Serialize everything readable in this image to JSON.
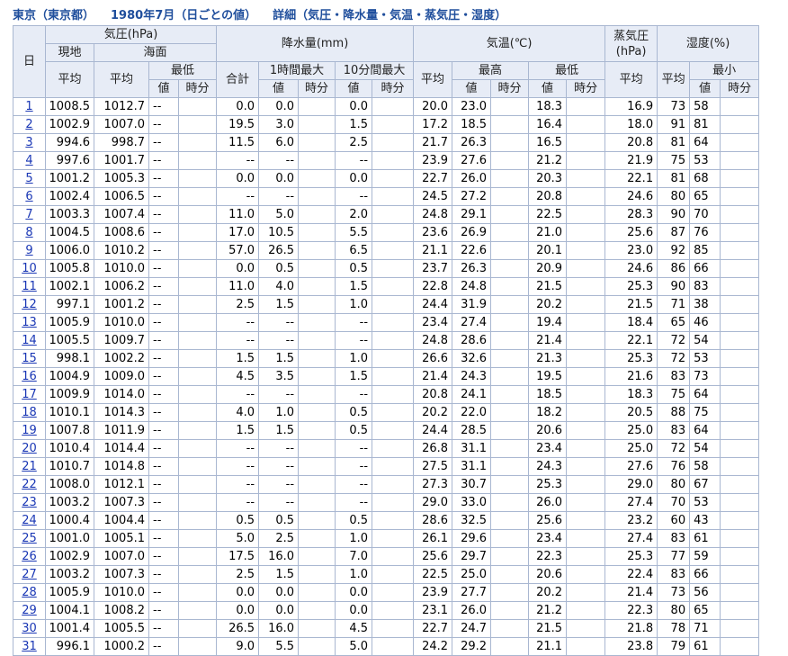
{
  "title": {
    "place": "東京（東京都）",
    "date": "1980年7月（日ごとの値）",
    "detail": "詳細（気圧・降水量・気温・蒸気圧・湿度）"
  },
  "headers": {
    "day": "日",
    "pressure": "気圧(hPa)",
    "station": "現地",
    "sea": "海面",
    "avg": "平均",
    "min": "最低",
    "value": "値",
    "time": "時分",
    "precip": "降水量(mm)",
    "total": "合計",
    "max1h": "1時間最大",
    "max10m": "10分間最大",
    "temp": "気温(℃)",
    "max": "最高",
    "vapor": "蒸気圧(hPa)",
    "humidity": "湿度(%)",
    "hmin": "最小"
  },
  "rows": [
    {
      "day": "1",
      "p_avg": "1008.5",
      "sp_avg": "1012.7",
      "sp_min": "--",
      "sp_min_t": "",
      "pr_total": "0.0",
      "pr_1h": "0.0",
      "pr_1h_t": "",
      "pr_10m": "0.0",
      "pr_10m_t": "",
      "t_avg": "20.0",
      "t_max": "23.0",
      "t_max_t": "",
      "t_min": "18.3",
      "t_min_t": "",
      "vp": "16.9",
      "h_avg": "73",
      "h_min": "58",
      "h_min_t": ""
    },
    {
      "day": "2",
      "p_avg": "1002.9",
      "sp_avg": "1007.0",
      "sp_min": "--",
      "sp_min_t": "",
      "pr_total": "19.5",
      "pr_1h": "3.0",
      "pr_1h_t": "",
      "pr_10m": "1.5",
      "pr_10m_t": "",
      "t_avg": "17.2",
      "t_max": "18.5",
      "t_max_t": "",
      "t_min": "16.4",
      "t_min_t": "",
      "vp": "18.0",
      "h_avg": "91",
      "h_min": "81",
      "h_min_t": ""
    },
    {
      "day": "3",
      "p_avg": "994.6",
      "sp_avg": "998.7",
      "sp_min": "--",
      "sp_min_t": "",
      "pr_total": "11.5",
      "pr_1h": "6.0",
      "pr_1h_t": "",
      "pr_10m": "2.5",
      "pr_10m_t": "",
      "t_avg": "21.7",
      "t_max": "26.3",
      "t_max_t": "",
      "t_min": "16.5",
      "t_min_t": "",
      "vp": "20.8",
      "h_avg": "81",
      "h_min": "64",
      "h_min_t": ""
    },
    {
      "day": "4",
      "p_avg": "997.6",
      "sp_avg": "1001.7",
      "sp_min": "--",
      "sp_min_t": "",
      "pr_total": "--",
      "pr_1h": "--",
      "pr_1h_t": "",
      "pr_10m": "--",
      "pr_10m_t": "",
      "t_avg": "23.9",
      "t_max": "27.6",
      "t_max_t": "",
      "t_min": "21.2",
      "t_min_t": "",
      "vp": "21.9",
      "h_avg": "75",
      "h_min": "53",
      "h_min_t": ""
    },
    {
      "day": "5",
      "p_avg": "1001.2",
      "sp_avg": "1005.3",
      "sp_min": "--",
      "sp_min_t": "",
      "pr_total": "0.0",
      "pr_1h": "0.0",
      "pr_1h_t": "",
      "pr_10m": "0.0",
      "pr_10m_t": "",
      "t_avg": "22.7",
      "t_max": "26.0",
      "t_max_t": "",
      "t_min": "20.3",
      "t_min_t": "",
      "vp": "22.1",
      "h_avg": "81",
      "h_min": "68",
      "h_min_t": ""
    },
    {
      "day": "6",
      "p_avg": "1002.4",
      "sp_avg": "1006.5",
      "sp_min": "--",
      "sp_min_t": "",
      "pr_total": "--",
      "pr_1h": "--",
      "pr_1h_t": "",
      "pr_10m": "--",
      "pr_10m_t": "",
      "t_avg": "24.5",
      "t_max": "27.2",
      "t_max_t": "",
      "t_min": "20.8",
      "t_min_t": "",
      "vp": "24.6",
      "h_avg": "80",
      "h_min": "65",
      "h_min_t": ""
    },
    {
      "day": "7",
      "p_avg": "1003.3",
      "sp_avg": "1007.4",
      "sp_min": "--",
      "sp_min_t": "",
      "pr_total": "11.0",
      "pr_1h": "5.0",
      "pr_1h_t": "",
      "pr_10m": "2.0",
      "pr_10m_t": "",
      "t_avg": "24.8",
      "t_max": "29.1",
      "t_max_t": "",
      "t_min": "22.5",
      "t_min_t": "",
      "vp": "28.3",
      "h_avg": "90",
      "h_min": "70",
      "h_min_t": ""
    },
    {
      "day": "8",
      "p_avg": "1004.5",
      "sp_avg": "1008.6",
      "sp_min": "--",
      "sp_min_t": "",
      "pr_total": "17.0",
      "pr_1h": "10.5",
      "pr_1h_t": "",
      "pr_10m": "5.5",
      "pr_10m_t": "",
      "t_avg": "23.6",
      "t_max": "26.9",
      "t_max_t": "",
      "t_min": "21.0",
      "t_min_t": "",
      "vp": "25.6",
      "h_avg": "87",
      "h_min": "76",
      "h_min_t": ""
    },
    {
      "day": "9",
      "p_avg": "1006.0",
      "sp_avg": "1010.2",
      "sp_min": "--",
      "sp_min_t": "",
      "pr_total": "57.0",
      "pr_1h": "26.5",
      "pr_1h_t": "",
      "pr_10m": "6.5",
      "pr_10m_t": "",
      "t_avg": "21.1",
      "t_max": "22.6",
      "t_max_t": "",
      "t_min": "20.1",
      "t_min_t": "",
      "vp": "23.0",
      "h_avg": "92",
      "h_min": "85",
      "h_min_t": ""
    },
    {
      "day": "10",
      "p_avg": "1005.8",
      "sp_avg": "1010.0",
      "sp_min": "--",
      "sp_min_t": "",
      "pr_total": "0.0",
      "pr_1h": "0.5",
      "pr_1h_t": "",
      "pr_10m": "0.5",
      "pr_10m_t": "",
      "t_avg": "23.7",
      "t_max": "26.3",
      "t_max_t": "",
      "t_min": "20.9",
      "t_min_t": "",
      "vp": "24.6",
      "h_avg": "86",
      "h_min": "66",
      "h_min_t": ""
    },
    {
      "day": "11",
      "p_avg": "1002.1",
      "sp_avg": "1006.2",
      "sp_min": "--",
      "sp_min_t": "",
      "pr_total": "11.0",
      "pr_1h": "4.0",
      "pr_1h_t": "",
      "pr_10m": "1.5",
      "pr_10m_t": "",
      "t_avg": "22.8",
      "t_max": "24.8",
      "t_max_t": "",
      "t_min": "21.5",
      "t_min_t": "",
      "vp": "25.3",
      "h_avg": "90",
      "h_min": "83",
      "h_min_t": ""
    },
    {
      "day": "12",
      "p_avg": "997.1",
      "sp_avg": "1001.2",
      "sp_min": "--",
      "sp_min_t": "",
      "pr_total": "2.5",
      "pr_1h": "1.5",
      "pr_1h_t": "",
      "pr_10m": "1.0",
      "pr_10m_t": "",
      "t_avg": "24.4",
      "t_max": "31.9",
      "t_max_t": "",
      "t_min": "20.2",
      "t_min_t": "",
      "vp": "21.5",
      "h_avg": "71",
      "h_min": "38",
      "h_min_t": ""
    },
    {
      "day": "13",
      "p_avg": "1005.9",
      "sp_avg": "1010.0",
      "sp_min": "--",
      "sp_min_t": "",
      "pr_total": "--",
      "pr_1h": "--",
      "pr_1h_t": "",
      "pr_10m": "--",
      "pr_10m_t": "",
      "t_avg": "23.4",
      "t_max": "27.4",
      "t_max_t": "",
      "t_min": "19.4",
      "t_min_t": "",
      "vp": "18.4",
      "h_avg": "65",
      "h_min": "46",
      "h_min_t": ""
    },
    {
      "day": "14",
      "p_avg": "1005.5",
      "sp_avg": "1009.7",
      "sp_min": "--",
      "sp_min_t": "",
      "pr_total": "--",
      "pr_1h": "--",
      "pr_1h_t": "",
      "pr_10m": "--",
      "pr_10m_t": "",
      "t_avg": "24.8",
      "t_max": "28.6",
      "t_max_t": "",
      "t_min": "21.4",
      "t_min_t": "",
      "vp": "22.1",
      "h_avg": "72",
      "h_min": "54",
      "h_min_t": ""
    },
    {
      "day": "15",
      "p_avg": "998.1",
      "sp_avg": "1002.2",
      "sp_min": "--",
      "sp_min_t": "",
      "pr_total": "1.5",
      "pr_1h": "1.5",
      "pr_1h_t": "",
      "pr_10m": "1.0",
      "pr_10m_t": "",
      "t_avg": "26.6",
      "t_max": "32.6",
      "t_max_t": "",
      "t_min": "21.3",
      "t_min_t": "",
      "vp": "25.3",
      "h_avg": "72",
      "h_min": "53",
      "h_min_t": ""
    },
    {
      "day": "16",
      "p_avg": "1004.9",
      "sp_avg": "1009.0",
      "sp_min": "--",
      "sp_min_t": "",
      "pr_total": "4.5",
      "pr_1h": "3.5",
      "pr_1h_t": "",
      "pr_10m": "1.5",
      "pr_10m_t": "",
      "t_avg": "21.4",
      "t_max": "24.3",
      "t_max_t": "",
      "t_min": "19.5",
      "t_min_t": "",
      "vp": "21.6",
      "h_avg": "83",
      "h_min": "73",
      "h_min_t": ""
    },
    {
      "day": "17",
      "p_avg": "1009.9",
      "sp_avg": "1014.0",
      "sp_min": "--",
      "sp_min_t": "",
      "pr_total": "--",
      "pr_1h": "--",
      "pr_1h_t": "",
      "pr_10m": "--",
      "pr_10m_t": "",
      "t_avg": "20.8",
      "t_max": "24.1",
      "t_max_t": "",
      "t_min": "18.5",
      "t_min_t": "",
      "vp": "18.3",
      "h_avg": "75",
      "h_min": "64",
      "h_min_t": ""
    },
    {
      "day": "18",
      "p_avg": "1010.1",
      "sp_avg": "1014.3",
      "sp_min": "--",
      "sp_min_t": "",
      "pr_total": "4.0",
      "pr_1h": "1.0",
      "pr_1h_t": "",
      "pr_10m": "0.5",
      "pr_10m_t": "",
      "t_avg": "20.2",
      "t_max": "22.0",
      "t_max_t": "",
      "t_min": "18.2",
      "t_min_t": "",
      "vp": "20.5",
      "h_avg": "88",
      "h_min": "75",
      "h_min_t": ""
    },
    {
      "day": "19",
      "p_avg": "1007.8",
      "sp_avg": "1011.9",
      "sp_min": "--",
      "sp_min_t": "",
      "pr_total": "1.5",
      "pr_1h": "1.5",
      "pr_1h_t": "",
      "pr_10m": "0.5",
      "pr_10m_t": "",
      "t_avg": "24.4",
      "t_max": "28.5",
      "t_max_t": "",
      "t_min": "20.6",
      "t_min_t": "",
      "vp": "25.0",
      "h_avg": "83",
      "h_min": "64",
      "h_min_t": ""
    },
    {
      "day": "20",
      "p_avg": "1010.4",
      "sp_avg": "1014.4",
      "sp_min": "--",
      "sp_min_t": "",
      "pr_total": "--",
      "pr_1h": "--",
      "pr_1h_t": "",
      "pr_10m": "--",
      "pr_10m_t": "",
      "t_avg": "26.8",
      "t_max": "31.1",
      "t_max_t": "",
      "t_min": "23.4",
      "t_min_t": "",
      "vp": "25.0",
      "h_avg": "72",
      "h_min": "54",
      "h_min_t": ""
    },
    {
      "day": "21",
      "p_avg": "1010.7",
      "sp_avg": "1014.8",
      "sp_min": "--",
      "sp_min_t": "",
      "pr_total": "--",
      "pr_1h": "--",
      "pr_1h_t": "",
      "pr_10m": "--",
      "pr_10m_t": "",
      "t_avg": "27.5",
      "t_max": "31.1",
      "t_max_t": "",
      "t_min": "24.3",
      "t_min_t": "",
      "vp": "27.6",
      "h_avg": "76",
      "h_min": "58",
      "h_min_t": ""
    },
    {
      "day": "22",
      "p_avg": "1008.0",
      "sp_avg": "1012.1",
      "sp_min": "--",
      "sp_min_t": "",
      "pr_total": "--",
      "pr_1h": "--",
      "pr_1h_t": "",
      "pr_10m": "--",
      "pr_10m_t": "",
      "t_avg": "27.3",
      "t_max": "30.7",
      "t_max_t": "",
      "t_min": "25.3",
      "t_min_t": "",
      "vp": "29.0",
      "h_avg": "80",
      "h_min": "67",
      "h_min_t": ""
    },
    {
      "day": "23",
      "p_avg": "1003.2",
      "sp_avg": "1007.3",
      "sp_min": "--",
      "sp_min_t": "",
      "pr_total": "--",
      "pr_1h": "--",
      "pr_1h_t": "",
      "pr_10m": "--",
      "pr_10m_t": "",
      "t_avg": "29.0",
      "t_max": "33.0",
      "t_max_t": "",
      "t_min": "26.0",
      "t_min_t": "",
      "vp": "27.4",
      "h_avg": "70",
      "h_min": "53",
      "h_min_t": ""
    },
    {
      "day": "24",
      "p_avg": "1000.4",
      "sp_avg": "1004.4",
      "sp_min": "--",
      "sp_min_t": "",
      "pr_total": "0.5",
      "pr_1h": "0.5",
      "pr_1h_t": "",
      "pr_10m": "0.5",
      "pr_10m_t": "",
      "t_avg": "28.6",
      "t_max": "32.5",
      "t_max_t": "",
      "t_min": "25.6",
      "t_min_t": "",
      "vp": "23.2",
      "h_avg": "60",
      "h_min": "43",
      "h_min_t": ""
    },
    {
      "day": "25",
      "p_avg": "1001.0",
      "sp_avg": "1005.1",
      "sp_min": "--",
      "sp_min_t": "",
      "pr_total": "5.0",
      "pr_1h": "2.5",
      "pr_1h_t": "",
      "pr_10m": "1.0",
      "pr_10m_t": "",
      "t_avg": "26.1",
      "t_max": "29.6",
      "t_max_t": "",
      "t_min": "23.4",
      "t_min_t": "",
      "vp": "27.4",
      "h_avg": "83",
      "h_min": "61",
      "h_min_t": ""
    },
    {
      "day": "26",
      "p_avg": "1002.9",
      "sp_avg": "1007.0",
      "sp_min": "--",
      "sp_min_t": "",
      "pr_total": "17.5",
      "pr_1h": "16.0",
      "pr_1h_t": "",
      "pr_10m": "7.0",
      "pr_10m_t": "",
      "t_avg": "25.6",
      "t_max": "29.7",
      "t_max_t": "",
      "t_min": "22.3",
      "t_min_t": "",
      "vp": "25.3",
      "h_avg": "77",
      "h_min": "59",
      "h_min_t": ""
    },
    {
      "day": "27",
      "p_avg": "1003.2",
      "sp_avg": "1007.3",
      "sp_min": "--",
      "sp_min_t": "",
      "pr_total": "2.5",
      "pr_1h": "1.5",
      "pr_1h_t": "",
      "pr_10m": "1.0",
      "pr_10m_t": "",
      "t_avg": "22.5",
      "t_max": "25.0",
      "t_max_t": "",
      "t_min": "20.6",
      "t_min_t": "",
      "vp": "22.4",
      "h_avg": "83",
      "h_min": "66",
      "h_min_t": ""
    },
    {
      "day": "28",
      "p_avg": "1005.9",
      "sp_avg": "1010.0",
      "sp_min": "--",
      "sp_min_t": "",
      "pr_total": "0.0",
      "pr_1h": "0.0",
      "pr_1h_t": "",
      "pr_10m": "0.0",
      "pr_10m_t": "",
      "t_avg": "23.9",
      "t_max": "27.7",
      "t_max_t": "",
      "t_min": "20.2",
      "t_min_t": "",
      "vp": "21.4",
      "h_avg": "73",
      "h_min": "56",
      "h_min_t": ""
    },
    {
      "day": "29",
      "p_avg": "1004.1",
      "sp_avg": "1008.2",
      "sp_min": "--",
      "sp_min_t": "",
      "pr_total": "0.0",
      "pr_1h": "0.0",
      "pr_1h_t": "",
      "pr_10m": "0.0",
      "pr_10m_t": "",
      "t_avg": "23.1",
      "t_max": "26.0",
      "t_max_t": "",
      "t_min": "21.2",
      "t_min_t": "",
      "vp": "22.3",
      "h_avg": "80",
      "h_min": "65",
      "h_min_t": ""
    },
    {
      "day": "30",
      "p_avg": "1001.4",
      "sp_avg": "1005.5",
      "sp_min": "--",
      "sp_min_t": "",
      "pr_total": "26.5",
      "pr_1h": "16.0",
      "pr_1h_t": "",
      "pr_10m": "4.5",
      "pr_10m_t": "",
      "t_avg": "22.7",
      "t_max": "24.7",
      "t_max_t": "",
      "t_min": "21.5",
      "t_min_t": "",
      "vp": "21.8",
      "h_avg": "78",
      "h_min": "71",
      "h_min_t": ""
    },
    {
      "day": "31",
      "p_avg": "996.1",
      "sp_avg": "1000.2",
      "sp_min": "--",
      "sp_min_t": "",
      "pr_total": "9.0",
      "pr_1h": "5.5",
      "pr_1h_t": "",
      "pr_10m": "5.0",
      "pr_10m_t": "",
      "t_avg": "24.2",
      "t_max": "29.2",
      "t_max_t": "",
      "t_min": "21.1",
      "t_min_t": "",
      "vp": "23.8",
      "h_avg": "79",
      "h_min": "61",
      "h_min_t": ""
    }
  ],
  "colors": {
    "header_bg": "#e7ecf6",
    "border": "#a9b7d1",
    "title": "#1f4e9c",
    "link": "#1a37b5"
  }
}
